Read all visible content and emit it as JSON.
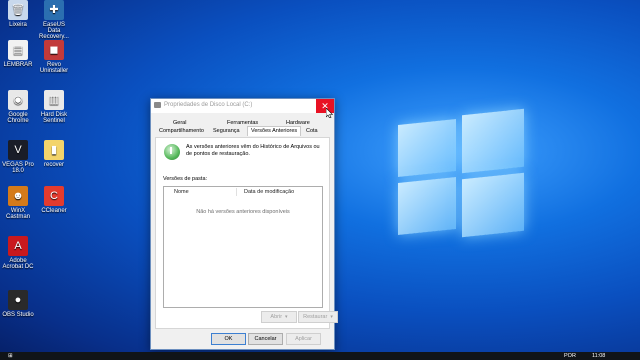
{
  "desktop": {
    "icons": [
      {
        "label": "Lixeira",
        "glyph": "🗑",
        "bg": "#c8d8ec"
      },
      {
        "label": "EaseUS Data Recovery...",
        "glyph": "✚",
        "bg": "#2b6fb0"
      },
      {
        "label": "LEMBRAR",
        "glyph": "▤",
        "bg": "#f2f2f2"
      },
      {
        "label": "Revo Uninstaller",
        "glyph": "◼",
        "bg": "#c23a3a"
      },
      {
        "label": "Google Chrome",
        "glyph": "◉",
        "bg": "#e8e8e8"
      },
      {
        "label": "Hard Disk Sentinel",
        "glyph": "▥",
        "bg": "#e9e9e9"
      },
      {
        "label": "VEGAS Pro 18.0",
        "glyph": "V",
        "bg": "#1a1d28"
      },
      {
        "label": "recover",
        "glyph": "▮",
        "bg": "#f3d46b"
      },
      {
        "label": "WinX Castman",
        "glyph": "☻",
        "bg": "#d47a1a"
      },
      {
        "label": "CCleaner",
        "glyph": "C",
        "bg": "#e33b2e"
      },
      {
        "label": "Adobe Acrobat DC",
        "glyph": "A",
        "bg": "#c9191e"
      },
      {
        "label": "OBS Studio",
        "glyph": "●",
        "bg": "#2a2a2a"
      }
    ]
  },
  "dialog": {
    "title": "Propriedades de Disco Local (C:)",
    "close_glyph": "✕",
    "tabs_row1": [
      "Geral",
      "Ferramentas",
      "Hardware"
    ],
    "tabs_row2": [
      "Compartilhamento",
      "Segurança",
      "Versões Anteriores",
      "Cota"
    ],
    "active_tab": "Versões Anteriores",
    "info_text": "As versões anteriores vêm do Histórico de Arquivos ou de pontos de restauração.",
    "folder_versions_label": "Versões de pasta:",
    "columns": [
      "Nome",
      "Data de modificação"
    ],
    "empty_message": "Não há versões anteriores disponíveis",
    "buttons": {
      "open": "Abrir",
      "restore": "Restaurar",
      "ok": "OK",
      "cancel": "Cancelar",
      "apply": "Aplicar"
    }
  },
  "taskbar": {
    "language": "POR",
    "time": "11:08"
  }
}
